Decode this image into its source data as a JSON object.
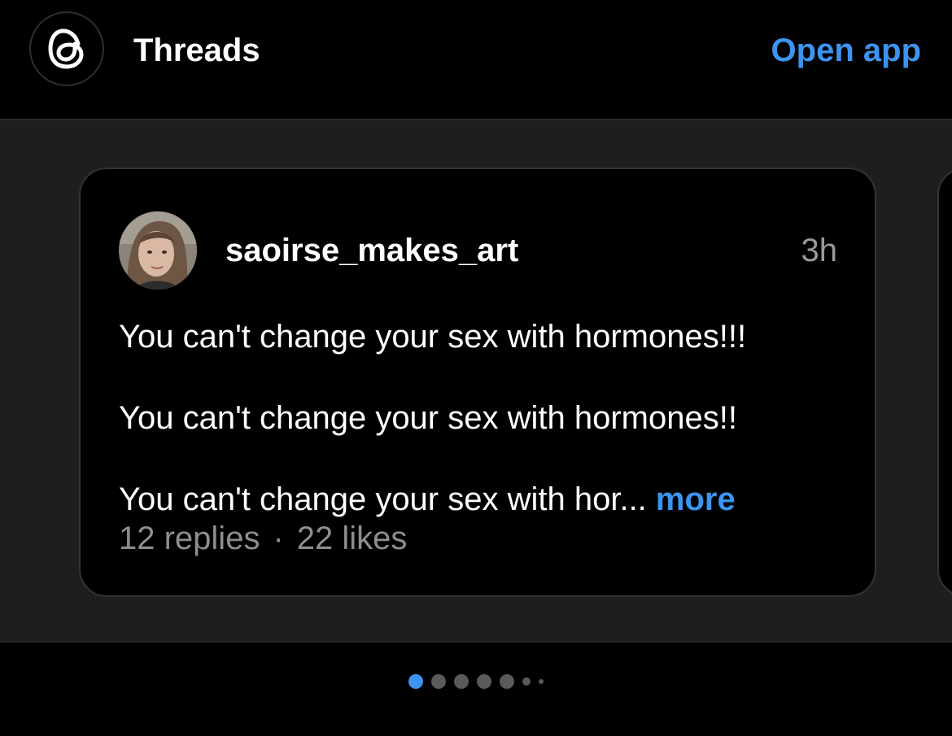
{
  "header": {
    "app_name": "Threads",
    "open_app_label": "Open app",
    "logo_icon": "threads-logo-icon"
  },
  "post": {
    "username": "saoirse_makes_art",
    "time": "3h",
    "lines": [
      "You can't change your sex with hormones!!!",
      "You can't change your sex with hormones!!",
      "You can't change your sex with hor..."
    ],
    "more_label": "more",
    "replies": "12 replies",
    "separator": "·",
    "likes": "22 likes"
  },
  "pagination": {
    "active_index": 0,
    "dot_count": 7
  },
  "colors": {
    "accent": "#3d94f0",
    "background": "#000000",
    "band": "#1e1e1e",
    "muted_text": "#8e8e8e"
  }
}
